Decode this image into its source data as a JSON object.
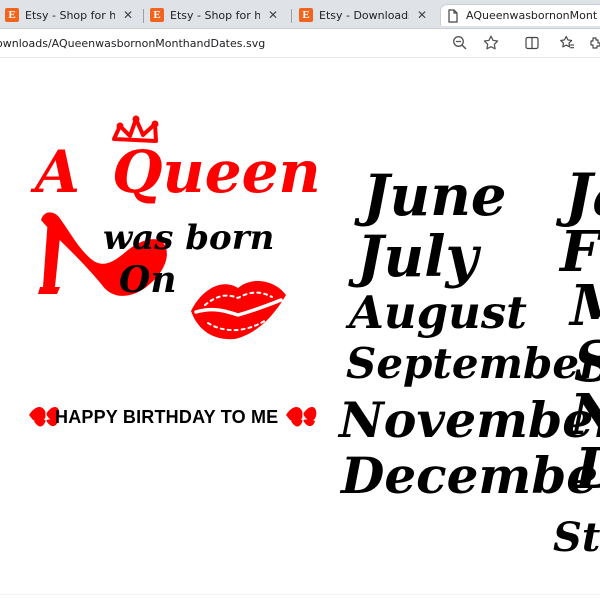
{
  "browser": {
    "tabs": [
      {
        "title": "Etsy - Shop for handmade",
        "favicon": "E",
        "active": false
      },
      {
        "title": "Etsy - Shop for handmade",
        "favicon": "E",
        "active": false
      },
      {
        "title": "Etsy - Downloads",
        "favicon": "E",
        "active": false
      },
      {
        "title": "AQueenwasbornonMonthandDates.svg",
        "favicon": "",
        "active": true
      }
    ],
    "address": {
      "url": "ownloads/AQueenwasbornonMonthandDates.svg"
    },
    "icons": {
      "close": "close-icon",
      "zoom": "zoom-out-icon",
      "star": "favorite-star-icon",
      "split": "split-screen-icon",
      "favorites": "favorites-icon",
      "extensions": "extensions-icon"
    }
  },
  "artwork": {
    "headline_a": "A",
    "headline_queen": "Queen",
    "line_was_born": "was born",
    "line_on": "On",
    "birthday": "HAPPY BIRTHDAY TO ME",
    "months_main": [
      "June",
      "July",
      "August",
      "September",
      "November",
      "December"
    ],
    "months_cut": [
      "Ja",
      "F",
      "M",
      "S",
      "N",
      "D"
    ],
    "cut_bottom": "St",
    "colors": {
      "red": "#ff0000",
      "black": "#000000"
    }
  }
}
